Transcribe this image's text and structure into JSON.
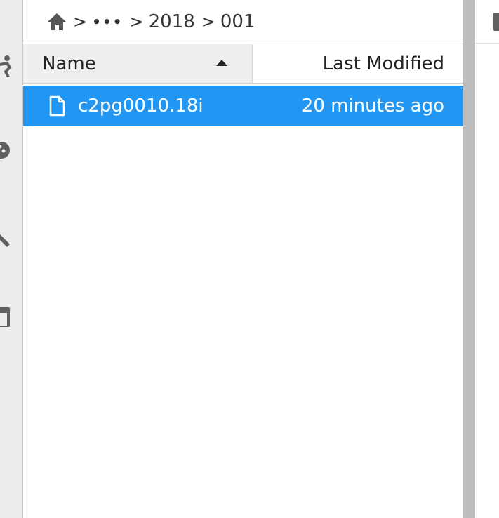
{
  "breadcrumb": {
    "home_icon": "home-icon",
    "separator": ">",
    "ellipsis": "•••",
    "items": [
      "2018",
      "001"
    ]
  },
  "columns": {
    "name": "Name",
    "last_modified": "Last Modified",
    "sort_direction": "ascending"
  },
  "files": [
    {
      "name": "c2pg0010.18i",
      "modified": "20 minutes ago",
      "icon": "file-icon",
      "selected": true
    }
  ],
  "sidebar_icons": [
    "running-icon",
    "palette-icon",
    "build-icon",
    "tab-icon"
  ],
  "colors": {
    "selection": "#2196f3",
    "header_bg": "#eeeeee",
    "rail_bg": "#ececec",
    "splitter": "#bdbdbd"
  }
}
